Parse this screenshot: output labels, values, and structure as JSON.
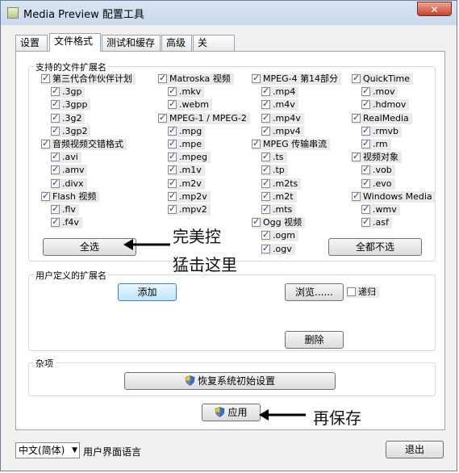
{
  "window": {
    "title": "Media Preview 配置工具",
    "close": "✕"
  },
  "tabs": [
    "设置",
    "文件格式",
    "测试和缓存",
    "高级",
    "关于......"
  ],
  "ext_group": {
    "label": "支持的文件扩展名"
  },
  "ext_columns": [
    [
      {
        "label": "第三代合作伙伴计划",
        "checked": true,
        "indent": false
      },
      {
        "label": ".3gp",
        "checked": true,
        "indent": true
      },
      {
        "label": ".3gpp",
        "checked": true,
        "indent": true
      },
      {
        "label": ".3g2",
        "checked": true,
        "indent": true
      },
      {
        "label": ".3gp2",
        "checked": true,
        "indent": true
      },
      {
        "label": "音频视频交错格式",
        "checked": true,
        "indent": false
      },
      {
        "label": ".avi",
        "checked": true,
        "indent": true
      },
      {
        "label": ".amv",
        "checked": true,
        "indent": true
      },
      {
        "label": ".divx",
        "checked": true,
        "indent": true
      },
      {
        "label": "Flash 视频",
        "checked": true,
        "indent": false
      },
      {
        "label": ".flv",
        "checked": true,
        "indent": true
      },
      {
        "label": ".f4v",
        "checked": true,
        "indent": true
      }
    ],
    [
      {
        "label": "Matroska 视频",
        "checked": true,
        "indent": false
      },
      {
        "label": ".mkv",
        "checked": true,
        "indent": true
      },
      {
        "label": ".webm",
        "checked": true,
        "indent": true
      },
      {
        "label": "MPEG-1 / MPEG-2",
        "checked": true,
        "indent": false
      },
      {
        "label": ".mpg",
        "checked": true,
        "indent": true
      },
      {
        "label": ".mpe",
        "checked": true,
        "indent": true
      },
      {
        "label": ".mpeg",
        "checked": true,
        "indent": true
      },
      {
        "label": ".m1v",
        "checked": true,
        "indent": true
      },
      {
        "label": ".m2v",
        "checked": true,
        "indent": true
      },
      {
        "label": ".mp2v",
        "checked": true,
        "indent": true
      },
      {
        "label": ".mpv2",
        "checked": true,
        "indent": true
      }
    ],
    [
      {
        "label": "MPEG-4 第14部分",
        "checked": true,
        "indent": false
      },
      {
        "label": ".mp4",
        "checked": true,
        "indent": true
      },
      {
        "label": ".m4v",
        "checked": true,
        "indent": true
      },
      {
        "label": ".mp4v",
        "checked": true,
        "indent": true
      },
      {
        "label": ".mpv4",
        "checked": true,
        "indent": true
      },
      {
        "label": "MPEG 传输串流",
        "checked": true,
        "indent": false
      },
      {
        "label": ".ts",
        "checked": true,
        "indent": true
      },
      {
        "label": ".tp",
        "checked": true,
        "indent": true
      },
      {
        "label": ".m2ts",
        "checked": true,
        "indent": true
      },
      {
        "label": ".m2t",
        "checked": true,
        "indent": true
      },
      {
        "label": ".mts",
        "checked": true,
        "indent": true
      },
      {
        "label": "Ogg 视频",
        "checked": true,
        "indent": false
      },
      {
        "label": ".ogm",
        "checked": true,
        "indent": true
      },
      {
        "label": ".ogv",
        "checked": true,
        "indent": true
      }
    ],
    [
      {
        "label": "QuickTime",
        "checked": true,
        "indent": false
      },
      {
        "label": ".mov",
        "checked": true,
        "indent": true
      },
      {
        "label": ".hdmov",
        "checked": true,
        "indent": true
      },
      {
        "label": "RealMedia",
        "checked": true,
        "indent": false
      },
      {
        "label": ".rmvb",
        "checked": true,
        "indent": true
      },
      {
        "label": ".rm",
        "checked": true,
        "indent": true
      },
      {
        "label": "视频对象",
        "checked": true,
        "indent": false
      },
      {
        "label": ".vob",
        "checked": true,
        "indent": true
      },
      {
        "label": ".evo",
        "checked": true,
        "indent": true
      },
      {
        "label": "Windows Media",
        "checked": true,
        "indent": false
      },
      {
        "label": ".wmv",
        "checked": true,
        "indent": true
      },
      {
        "label": ".asf",
        "checked": true,
        "indent": true
      }
    ]
  ],
  "buttons": {
    "select_all": "全选",
    "select_none": "全都不选",
    "add": "添加",
    "browse": "浏览......",
    "delete": "删除",
    "restore": "恢复系统初始设置",
    "apply": "应用",
    "exit": "退出"
  },
  "user_group": {
    "label": "用户定义的扩展名",
    "recursive": "递归"
  },
  "misc_group": {
    "label": "杂项"
  },
  "language": {
    "selected": "中文(简体)",
    "label": "用户界面语言"
  },
  "annotations": {
    "line1": "完美控",
    "line2": "猛击这里",
    "line3": "再保存"
  }
}
